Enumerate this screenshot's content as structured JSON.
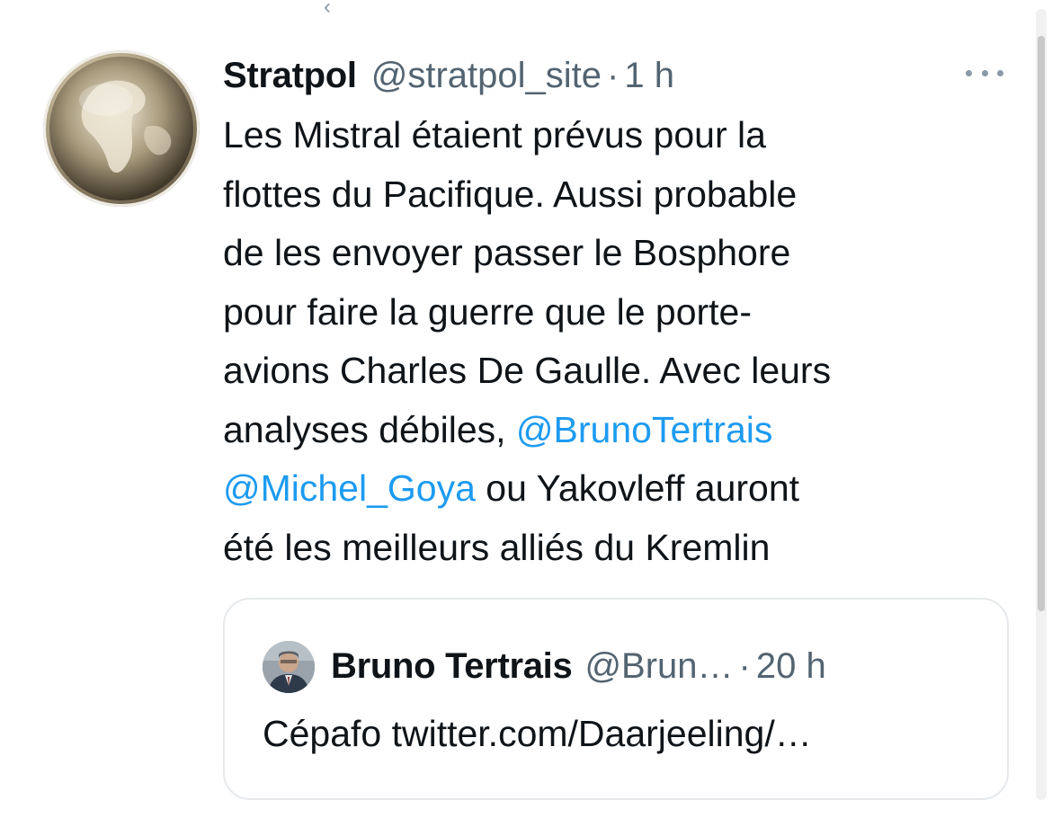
{
  "tweet": {
    "display_name": "Stratpol",
    "handle": "@stratpol_site",
    "separator": "·",
    "time": "1 h",
    "more_icon": "more-horizontal-icon",
    "text_lines": [
      {
        "before": "Les Mistral étaient prévus pour la",
        "mention": "",
        "after": ""
      },
      {
        "before": "flottes du Pacifique. Aussi probable",
        "mention": "",
        "after": ""
      },
      {
        "before": "de les envoyer passer le Bosphore",
        "mention": "",
        "after": ""
      },
      {
        "before": "pour faire la guerre que le porte-",
        "mention": "",
        "after": ""
      },
      {
        "before": "avions Charles De Gaulle. Avec leurs",
        "mention": "",
        "after": ""
      },
      {
        "before": "analyses débiles, ",
        "mention": "@BrunoTertrais",
        "after": ""
      },
      {
        "before": "",
        "mention": "@Michel_Goya",
        "after": " ou Yakovleff auront"
      },
      {
        "before": "été les meilleurs alliés du Kremlin",
        "mention": "",
        "after": ""
      }
    ]
  },
  "quote": {
    "display_name": "Bruno Tertrais",
    "handle": "@Brun…",
    "separator": "·",
    "time": "20 h",
    "text": "Cépafo twitter.com/Daarjeeling/…"
  },
  "colors": {
    "text": "#0f1419",
    "secondary": "#536471",
    "link": "#1d9bf0",
    "border": "#e6e9ec"
  }
}
